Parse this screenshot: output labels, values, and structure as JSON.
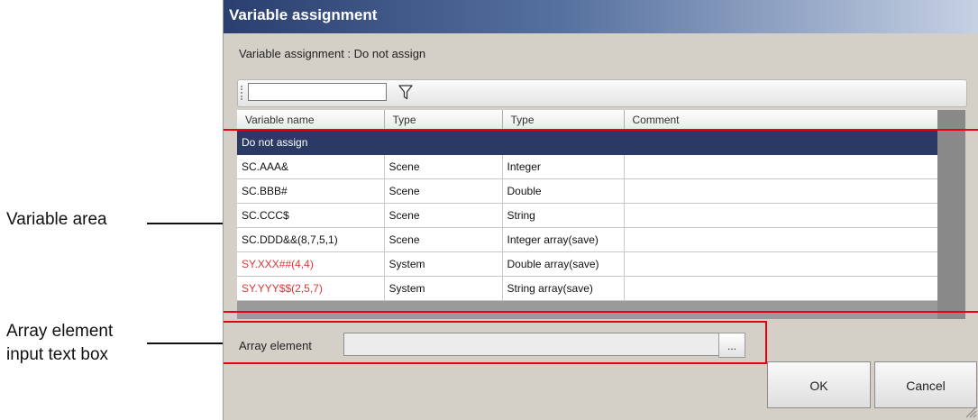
{
  "annotations": {
    "variable_area": "Variable area",
    "array_element_box_line1": "Array element",
    "array_element_box_line2": "input text box"
  },
  "dialog": {
    "title": "Variable assignment",
    "subtitle": "Variable assignment : Do not assign",
    "filter": {
      "value": "",
      "placeholder": ""
    },
    "columns": [
      "Variable name",
      "Type",
      "Type",
      "Comment"
    ],
    "rows": [
      {
        "name": "Do not assign",
        "type1": "",
        "type2": "",
        "comment": ""
      },
      {
        "name": "SC.AAA&",
        "type1": "Scene",
        "type2": "Integer",
        "comment": ""
      },
      {
        "name": "SC.BBB#",
        "type1": "Scene",
        "type2": "Double",
        "comment": ""
      },
      {
        "name": "SC.CCC$",
        "type1": "Scene",
        "type2": "String",
        "comment": ""
      },
      {
        "name": "SC.DDD&&(8,7,5,1)",
        "type1": "Scene",
        "type2": "Integer array(save)",
        "comment": ""
      },
      {
        "name": "SY.XXX##(4,4)",
        "type1": "System",
        "type2": "Double array(save)",
        "comment": ""
      },
      {
        "name": "SY.YYY$$(2,5,7)",
        "type1": "System",
        "type2": "String array(save)",
        "comment": ""
      }
    ],
    "array_element": {
      "label": "Array element",
      "value": "",
      "browse_label": "..."
    },
    "ok_label": "OK",
    "cancel_label": "Cancel"
  },
  "colors": {
    "selection": "#2a3a64",
    "system_variable_text": "#e03535",
    "callout_box": "#e60012"
  },
  "icons": {
    "filter": "funnel-icon",
    "resize": "resize-grip-icon"
  }
}
